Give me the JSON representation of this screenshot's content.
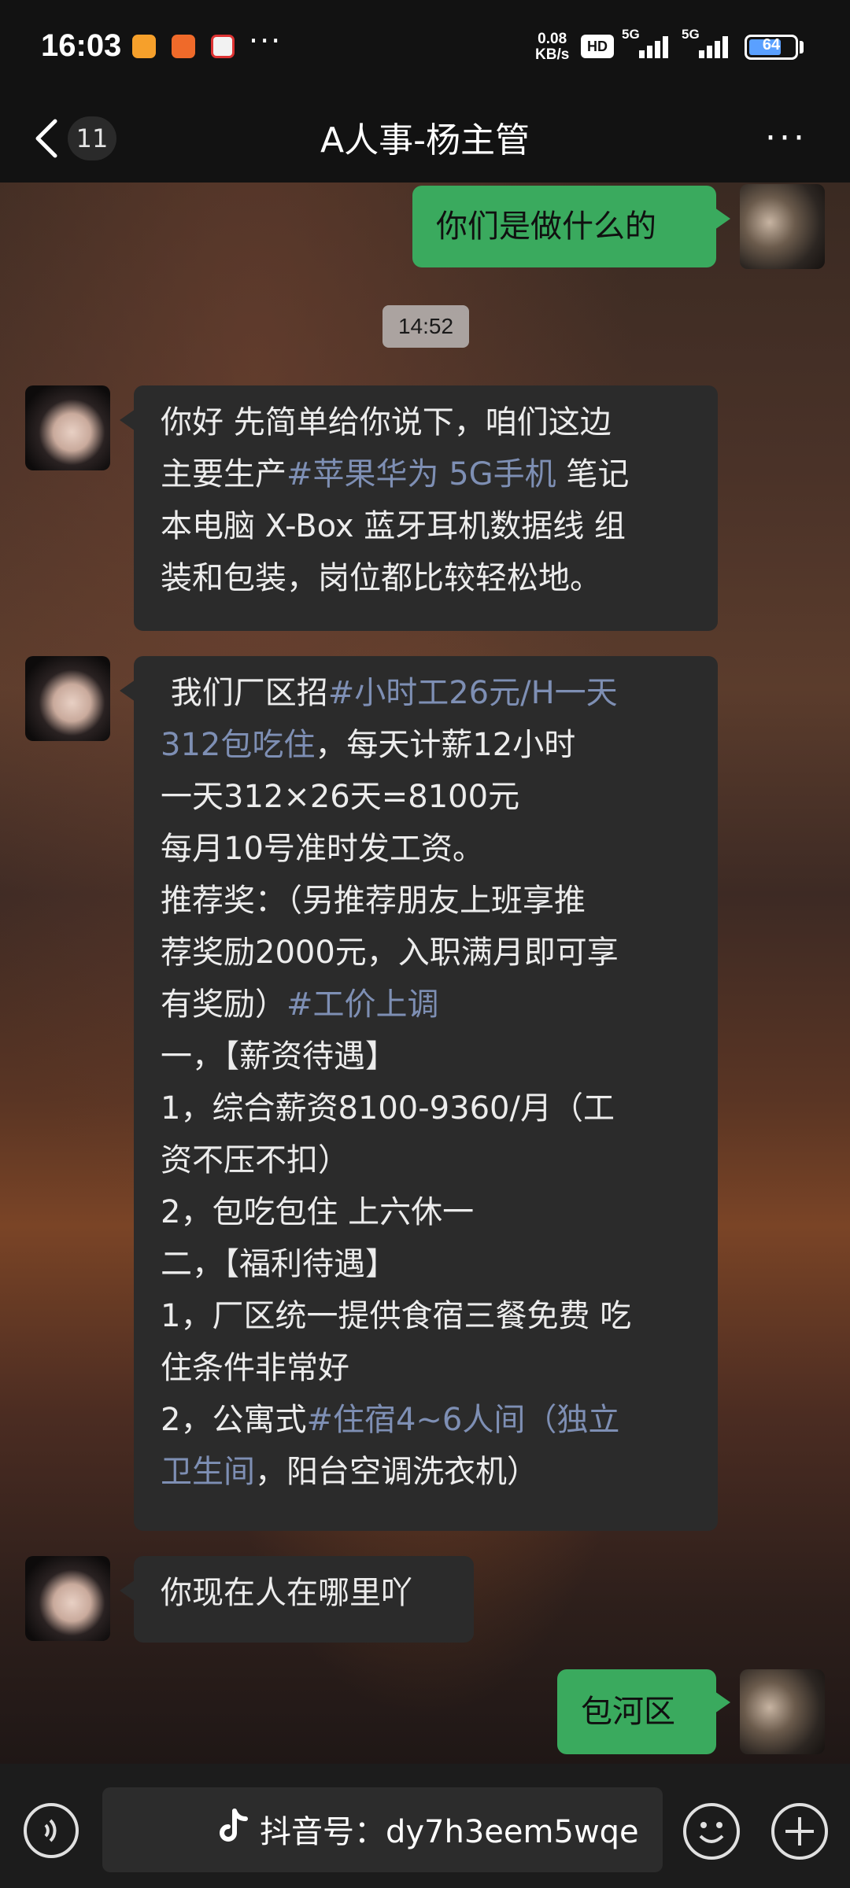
{
  "status_bar": {
    "time": "16:03",
    "dots": "···",
    "net_speed_value": "0.08",
    "net_speed_unit": "KB/s",
    "hd_label": "HD",
    "signal_label_1": "5G",
    "signal_label_2": "5G",
    "battery_level": "64"
  },
  "nav": {
    "unread_count": "11",
    "title": "A人事-杨主管",
    "more_label": "···"
  },
  "messages": [
    {
      "side": "out",
      "lines": [
        [
          "你们是做什么的"
        ]
      ]
    },
    {
      "side": "time",
      "text": "14:52"
    },
    {
      "side": "in",
      "lines": [
        [
          "你好 先简单给你说下，咱们这边"
        ],
        [
          "主要生产",
          "#苹果华为 5G手机",
          " 笔记"
        ],
        [
          "本电脑 X-Box 蓝牙耳机数据线 组"
        ],
        [
          "装和包装，岗位都比较轻松地。"
        ]
      ]
    },
    {
      "side": "in",
      "lines": [
        [
          " 我们厂区招",
          "#小时工26元/H一天"
        ],
        [
          "",
          "312包吃住",
          "，每天计薪12小时"
        ],
        [
          "一天312×26天=8100元"
        ],
        [
          "每月10号准时发工资。"
        ],
        [
          "推荐奖：（另推荐朋友上班享推"
        ],
        [
          "荐奖励2000元，入职满月即可享"
        ],
        [
          "有奖励）",
          "#工价上调"
        ],
        [
          "一，【薪资待遇】"
        ],
        [
          "1，综合薪资8100-9360/月（工"
        ],
        [
          "资不压不扣）"
        ],
        [
          "2，包吃包住 上六休一"
        ],
        [
          "二，【福利待遇】"
        ],
        [
          "1，厂区统一提供食宿三餐免费 吃"
        ],
        [
          "住条件非常好"
        ],
        [
          "2，公寓式",
          "#住宿4~6人间（独立"
        ],
        [
          "",
          "卫生间",
          "，阳台空调洗衣机）"
        ]
      ]
    },
    {
      "side": "in",
      "lines": [
        [
          "你现在人在哪里吖"
        ]
      ]
    },
    {
      "side": "out",
      "lines": [
        [
          "包河区"
        ]
      ]
    }
  ],
  "input_bar": {
    "watermark_text": "抖音号：dy7h3eem5wqe"
  },
  "colors": {
    "outgoing_bubble": "#3aaa5e",
    "incoming_bubble": "#2b2b2b",
    "hashtag": "#7e8fb4"
  }
}
